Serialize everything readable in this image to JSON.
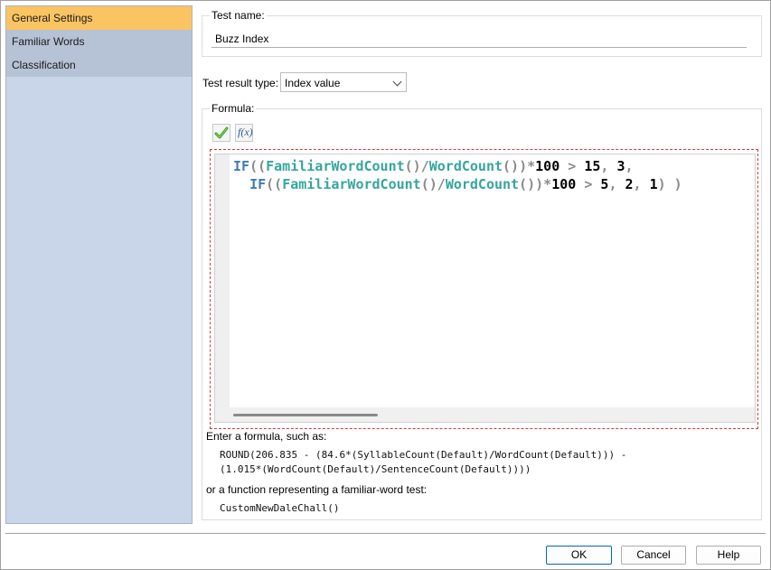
{
  "sidebar": {
    "items": [
      {
        "label": "General Settings"
      },
      {
        "label": "Familiar Words"
      },
      {
        "label": "Classification"
      }
    ]
  },
  "test_name": {
    "title": "Test name:",
    "value": "Buzz Index"
  },
  "result_type": {
    "label": "Test result type:",
    "selected": "Index value"
  },
  "formula": {
    "title": "Formula:",
    "validate_icon": "checkmark-icon",
    "insert_function_icon": "fx-icon",
    "fx_label": "f(x)",
    "code": {
      "l1_kw": "IF",
      "l1_p1": "((",
      "l1_fn1": "FamiliarWordCount",
      "l1_p2": "()/",
      "l1_fn2": "WordCount",
      "l1_p3": "())*",
      "l1_n1": "100",
      "l1_op": " > ",
      "l1_n2": "15",
      "l1_c1": ", ",
      "l1_n3": "3",
      "l1_c2": ",",
      "l2_kw": "IF",
      "l2_p1": "((",
      "l2_fn1": "FamiliarWordCount",
      "l2_p2": "()/",
      "l2_fn2": "WordCount",
      "l2_p3": "())*",
      "l2_n1": "100",
      "l2_op": " > ",
      "l2_n2": "5",
      "l2_c1": ", ",
      "l2_n3": "2",
      "l2_c2": ", ",
      "l2_n4": "1",
      "l2_end": ") )"
    }
  },
  "hints": {
    "intro": "Enter a formula, such as:",
    "example1_line1": "ROUND(206.835 - (84.6*(SyllableCount(Default)/WordCount(Default))) -",
    "example1_line2": "(1.015*(WordCount(Default)/SentenceCount(Default))))",
    "or_text": "or a function representing a familiar-word test:",
    "example2": "CustomNewDaleChall()"
  },
  "buttons": {
    "ok": "OK",
    "cancel": "Cancel",
    "help": "Help"
  },
  "colors": {
    "active_sidebar": "#fbc463",
    "keyword": "#3e7ab8",
    "function": "#35a69d"
  }
}
